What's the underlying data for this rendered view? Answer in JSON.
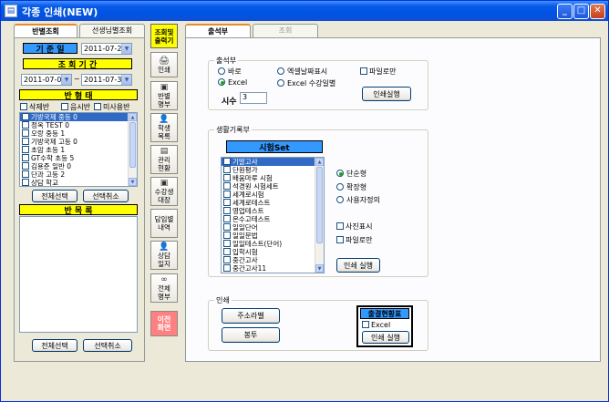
{
  "window": {
    "title": "각종 인쇄(NEW)",
    "controls": {
      "minimize": "_",
      "maximize": "□",
      "close": "✕"
    }
  },
  "left_tabs": [
    "반별조회",
    "선생님별조회"
  ],
  "date_filter": {
    "base_label": "기 준 일",
    "base_date": "2011-07-21",
    "period_label": "조 회 기 간",
    "from": "2011-07-01",
    "tilde": "~",
    "to": "2011-07-31"
  },
  "class_form": {
    "header": "반 형 태",
    "checks": [
      "삭제반",
      "음시반",
      "미사용반"
    ],
    "items": [
      "기방국제 중등 0",
      "정옥 TEST 0",
      "오랑 중등 1",
      "기방국제 고등 0",
      "초암 초등 1",
      "GT수학 초등 5",
      "김용준 일반 0",
      "단과 고등 2",
      "상담 학교"
    ],
    "select_all": "전체선택",
    "deselect": "선택취소"
  },
  "class_list": {
    "header": "반 목 록",
    "select_all": "전체선택",
    "deselect": "선택취소"
  },
  "nav": {
    "top": "조회및\n출력기",
    "items": [
      {
        "label": "인쇄",
        "icon": "🖨"
      },
      {
        "label": "반별\n명부",
        "icon": "▣"
      },
      {
        "label": "학생\n목록",
        "icon": "👤"
      },
      {
        "label": "관리\n현황",
        "icon": "▤"
      },
      {
        "label": "수강생\n대장",
        "icon": "▣"
      },
      {
        "label": "담임별\n내역",
        "icon": ""
      },
      {
        "label": "상담\n일지",
        "icon": "👤"
      },
      {
        "label": "전체\n명부",
        "icon": "∞"
      }
    ],
    "close": "이전\n화면"
  },
  "main_tabs": [
    "출석부",
    "조회"
  ],
  "attendance": {
    "legend": "출석부",
    "radios": [
      "바로",
      "Excel"
    ],
    "radio_selected": 1,
    "radios2": [
      "엑셀날짜표시",
      "Excel 수강일별"
    ],
    "file_only": "파일로만",
    "hours_label": "시수",
    "hours_value": "3",
    "print_button": "인쇄실행"
  },
  "life_record": {
    "legend": "생활기록부",
    "header": "시험Set",
    "items": [
      "기말고사",
      "단원평가",
      "배움마루 시험",
      "석경원 시험세트",
      "세계로시험",
      "세계로테스트",
      "영업테스트",
      "온수고테스트",
      "일일단어",
      "일일문법",
      "일일테스트(단어)",
      "입학시험",
      "중간고사",
      "중간고사11"
    ],
    "options": [
      "단순형",
      "확장형",
      "사용자정의"
    ],
    "option_selected": 0,
    "checks": [
      "사진표시",
      "파일로만"
    ],
    "print_button": "인쇄 실행"
  },
  "print_section": {
    "legend": "인쇄",
    "address_label": "주소라벨",
    "envelope": "봉투",
    "attendance_table": "출결현황표",
    "excel": "Excel",
    "print_button": "인쇄 실행"
  }
}
